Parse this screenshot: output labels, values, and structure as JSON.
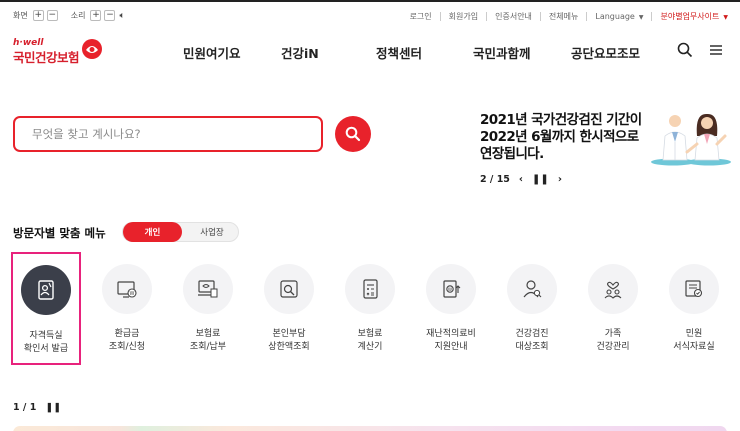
{
  "utility": {
    "screen_label": "화면",
    "sound_label": "소리",
    "links": [
      "로그인",
      "회원가입",
      "인증서안내",
      "전체메뉴",
      "Language"
    ],
    "biz_site": "분야별업무사이트"
  },
  "logo": {
    "sub": "h·well",
    "name": "국민건강보험"
  },
  "gnb": [
    "민원여기요",
    "건강iN",
    "정책센터",
    "국민과함께",
    "공단요모조모"
  ],
  "search": {
    "placeholder": "무엇을 찾고 계시나요?"
  },
  "notice": {
    "lines": [
      "2021년 국가건강검진 기간이",
      "2022년 6월까지 한시적으로",
      "연장됩니다."
    ],
    "page": "2 / 15"
  },
  "visitor_menu": {
    "title": "방문자별 맞춤 메뉴",
    "tabs": [
      "개인",
      "사업장"
    ],
    "active_tab": "개인",
    "items": [
      {
        "label": "자격득실\n확인서 발급",
        "icon": "certificate-icon"
      },
      {
        "label": "환급금\n조회/신청",
        "icon": "refund-monitor-icon"
      },
      {
        "label": "보험료\n조회/납부",
        "icon": "premium-payment-icon"
      },
      {
        "label": "본인부담\n상한액조회",
        "icon": "copay-search-icon"
      },
      {
        "label": "보험료\n계산기",
        "icon": "calculator-icon"
      },
      {
        "label": "재난적의료비\n지원안내",
        "icon": "medical-cost-icon"
      },
      {
        "label": "건강검진\n대상조회",
        "icon": "checkup-person-icon"
      },
      {
        "label": "가족\n건강관리",
        "icon": "family-icon"
      },
      {
        "label": "민원\n서식자료실",
        "icon": "forms-icon"
      }
    ],
    "page": "1 / 1"
  },
  "colors": {
    "brand_red": "#e8222b",
    "active_pink": "#e8227c",
    "dark_circle": "#3b3f4a"
  }
}
